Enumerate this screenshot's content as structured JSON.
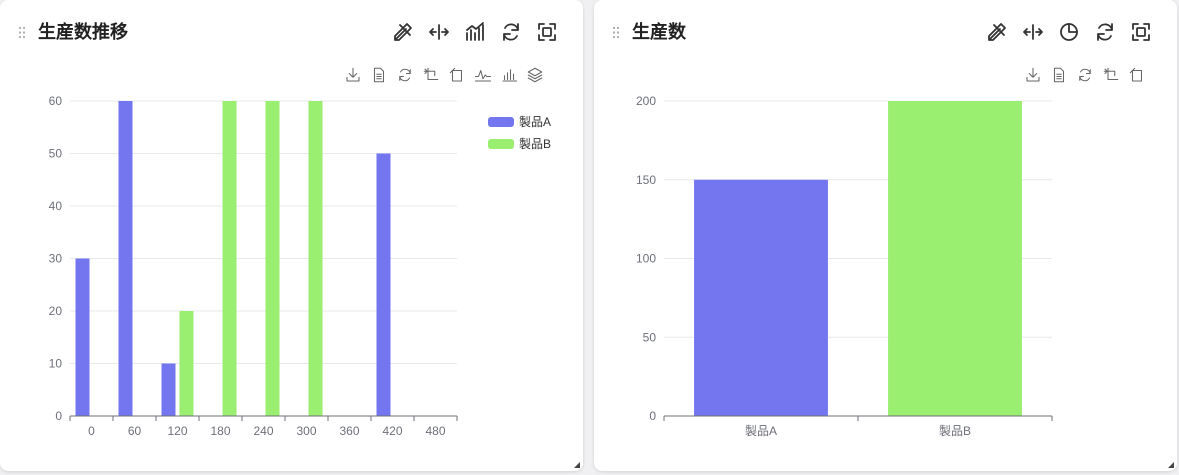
{
  "panels": [
    {
      "title": "生産数推移",
      "header_icons": [
        "pencil-ruler-icon",
        "move-horizontal-icon",
        "line-chart-icon",
        "refresh-icon",
        "fullscreen-icon"
      ],
      "toolbar_icons": [
        "download-icon",
        "data-view-icon",
        "restore-icon",
        "zoom-icon",
        "zoom-reset-icon",
        "line-type-icon",
        "bar-type-icon",
        "stack-icon"
      ]
    },
    {
      "title": "生産数",
      "header_icons": [
        "pencil-ruler-icon",
        "move-horizontal-icon",
        "pie-chart-icon",
        "refresh-icon",
        "fullscreen-icon"
      ],
      "toolbar_icons": [
        "download-icon",
        "data-view-icon",
        "restore-icon",
        "zoom-icon",
        "zoom-reset-icon"
      ]
    }
  ],
  "colors": {
    "series_a": "#7376ef",
    "series_b": "#9aee70",
    "grid": "#e8e8ec",
    "axis": "#6e7079",
    "text": "#6e7079"
  },
  "chart_data": [
    {
      "type": "bar",
      "categories": [
        "0",
        "60",
        "120",
        "180",
        "240",
        "300",
        "360",
        "420",
        "480"
      ],
      "series": [
        {
          "name": "製品A",
          "values": [
            30,
            60,
            10,
            0,
            0,
            0,
            0,
            50,
            0
          ]
        },
        {
          "name": "製品B",
          "values": [
            0,
            0,
            20,
            60,
            60,
            60,
            0,
            0,
            0
          ]
        }
      ],
      "yticks": [
        "0",
        "10",
        "20",
        "30",
        "40",
        "50",
        "60"
      ],
      "ylim": [
        0,
        60
      ],
      "grid": true,
      "legend_position": "top-right",
      "title": "",
      "xlabel": "",
      "ylabel": ""
    },
    {
      "type": "bar",
      "categories": [
        "製品A",
        "製品B"
      ],
      "values": [
        150,
        200
      ],
      "yticks": [
        "0",
        "50",
        "100",
        "150",
        "200"
      ],
      "ylim": [
        0,
        200
      ],
      "grid": true,
      "title": "",
      "xlabel": "",
      "ylabel": ""
    }
  ]
}
